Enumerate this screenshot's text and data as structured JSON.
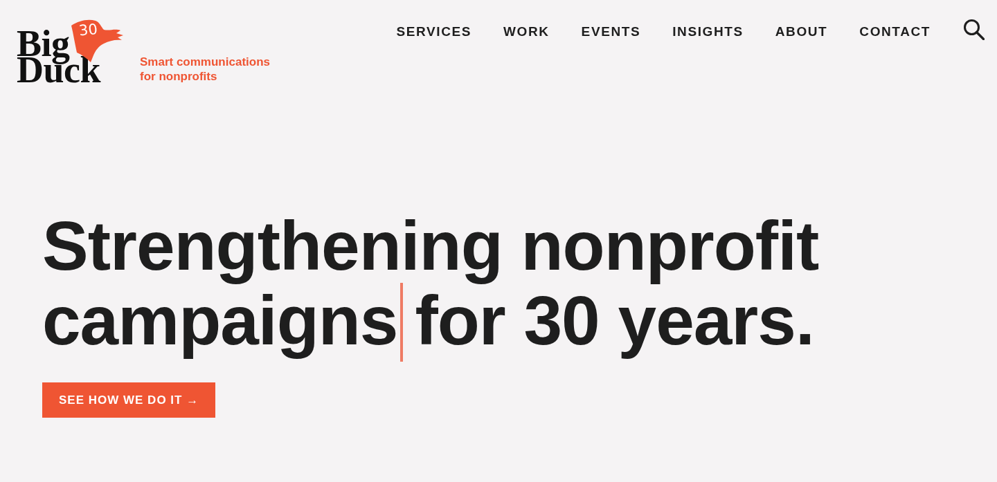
{
  "header": {
    "logo": {
      "line_1": "Big",
      "line_2": "Duck",
      "flag_text": "30"
    },
    "tagline": "Smart communications for nonprofits",
    "nav": [
      "SERVICES",
      "WORK",
      "EVENTS",
      "INSIGHTS",
      "ABOUT",
      "CONTACT"
    ]
  },
  "hero": {
    "headline": {
      "first_line": "Strengthening nonprofit",
      "second_line_before_cursor": "campaigns",
      "second_line_after_cursor": "for 30 years.",
      "cursor_visible": true
    },
    "button": "SEE HOW WE DO IT →"
  }
}
